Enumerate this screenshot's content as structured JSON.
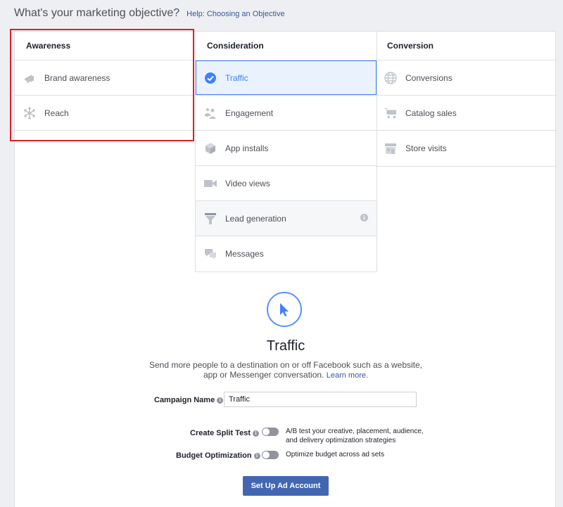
{
  "header": {
    "title": "What's your marketing objective?",
    "help_link": "Help: Choosing an Objective"
  },
  "columns": [
    {
      "heading": "Awareness",
      "items": [
        {
          "label": "Brand awareness",
          "icon": "megaphone-icon"
        },
        {
          "label": "Reach",
          "icon": "reach-burst-icon"
        }
      ]
    },
    {
      "heading": "Consideration",
      "items": [
        {
          "label": "Traffic",
          "icon": "checkmark-circle-icon",
          "selected": true
        },
        {
          "label": "Engagement",
          "icon": "people-icon"
        },
        {
          "label": "App installs",
          "icon": "box-icon"
        },
        {
          "label": "Video views",
          "icon": "video-camera-icon"
        },
        {
          "label": "Lead generation",
          "icon": "funnel-icon",
          "info_icon": true
        },
        {
          "label": "Messages",
          "icon": "chat-bubbles-icon"
        }
      ]
    },
    {
      "heading": "Conversion",
      "items": [
        {
          "label": "Conversions",
          "icon": "globe-icon"
        },
        {
          "label": "Catalog sales",
          "icon": "shopping-cart-icon"
        },
        {
          "label": "Store visits",
          "icon": "store-icon"
        }
      ]
    }
  ],
  "detail": {
    "icon": "cursor-arrow-icon",
    "title": "Traffic",
    "description": "Send more people to a destination on or off Facebook such as a website, app or Messenger conversation.",
    "learn_more": "Learn more."
  },
  "form": {
    "campaign_name_label": "Campaign Name",
    "campaign_name_value": "Traffic",
    "split_test_label": "Create Split Test",
    "split_test_text_line1": "A/B test your creative, placement, audience,",
    "split_test_text_line2": "and delivery optimization strategies",
    "split_test_on": false,
    "budget_label": "Budget Optimization",
    "budget_text": "Optimize budget across ad sets",
    "budget_on": false,
    "submit_label": "Set Up Ad Account"
  },
  "colors": {
    "accent": "#4080ff",
    "button": "#4267b2",
    "highlight_box": "#e02020",
    "icon_gray": "#bec3c9"
  }
}
